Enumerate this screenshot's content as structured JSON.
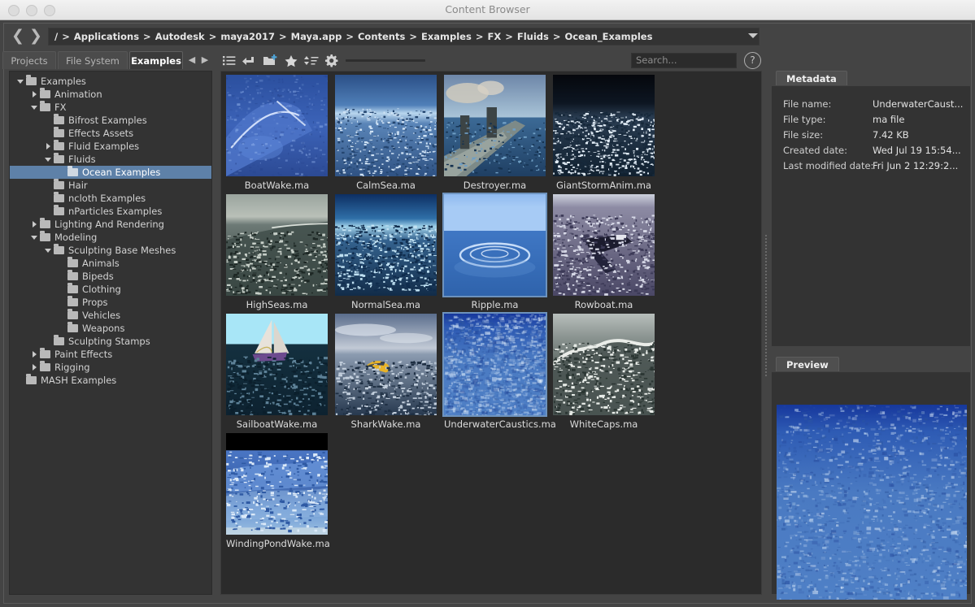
{
  "window": {
    "title": "Content Browser",
    "traffic_lights": [
      "close",
      "minimize",
      "zoom"
    ]
  },
  "breadcrumb": {
    "back_icon": "chevron-left-icon",
    "forward_icon": "chevron-right-icon",
    "segments": [
      "/",
      "Applications",
      "Autodesk",
      "maya2017",
      "Maya.app",
      "Contents",
      "Examples",
      "FX",
      "Fluids",
      "Ocean_Examples"
    ],
    "separator": ">",
    "dropdown_icon": "chevron-down-icon"
  },
  "tabs": [
    {
      "label": "Projects",
      "active": false
    },
    {
      "label": "File System",
      "active": false
    },
    {
      "label": "Examples",
      "active": true
    }
  ],
  "toolbar": {
    "icons": [
      {
        "name": "list-view-icon",
        "tip": "List view"
      },
      {
        "name": "up-one-level-icon",
        "tip": "Up one level"
      },
      {
        "name": "new-folder-icon",
        "tip": "New folder"
      },
      {
        "name": "favorite-star-icon",
        "tip": "Favorites"
      },
      {
        "name": "sort-icon",
        "tip": "Sort"
      },
      {
        "name": "settings-gear-icon",
        "tip": "Settings"
      }
    ],
    "zoom_slider_value": 25,
    "help_label": "?"
  },
  "search": {
    "value": "",
    "placeholder": "Search..."
  },
  "tree": {
    "items": [
      {
        "label": "Examples",
        "depth": 0,
        "twist": "open",
        "selected": false
      },
      {
        "label": "Animation",
        "depth": 1,
        "twist": "closed",
        "selected": false
      },
      {
        "label": "FX",
        "depth": 1,
        "twist": "open",
        "selected": false
      },
      {
        "label": "Bifrost Examples",
        "depth": 2,
        "twist": "none",
        "selected": false
      },
      {
        "label": "Effects Assets",
        "depth": 2,
        "twist": "none",
        "selected": false
      },
      {
        "label": "Fluid Examples",
        "depth": 2,
        "twist": "closed",
        "selected": false
      },
      {
        "label": "Fluids",
        "depth": 2,
        "twist": "open",
        "selected": false
      },
      {
        "label": "Ocean Examples",
        "depth": 3,
        "twist": "none",
        "selected": true
      },
      {
        "label": "Hair",
        "depth": 2,
        "twist": "none",
        "selected": false
      },
      {
        "label": "ncloth Examples",
        "depth": 2,
        "twist": "none",
        "selected": false
      },
      {
        "label": "nParticles Examples",
        "depth": 2,
        "twist": "none",
        "selected": false
      },
      {
        "label": "Lighting And Rendering",
        "depth": 1,
        "twist": "closed",
        "selected": false
      },
      {
        "label": "Modeling",
        "depth": 1,
        "twist": "open",
        "selected": false
      },
      {
        "label": "Sculpting Base Meshes",
        "depth": 2,
        "twist": "open",
        "selected": false
      },
      {
        "label": "Animals",
        "depth": 3,
        "twist": "none",
        "selected": false
      },
      {
        "label": "Bipeds",
        "depth": 3,
        "twist": "none",
        "selected": false
      },
      {
        "label": "Clothing",
        "depth": 3,
        "twist": "none",
        "selected": false
      },
      {
        "label": "Props",
        "depth": 3,
        "twist": "none",
        "selected": false
      },
      {
        "label": "Vehicles",
        "depth": 3,
        "twist": "none",
        "selected": false
      },
      {
        "label": "Weapons",
        "depth": 3,
        "twist": "none",
        "selected": false
      },
      {
        "label": "Sculpting Stamps",
        "depth": 2,
        "twist": "none",
        "selected": false
      },
      {
        "label": "Paint Effects",
        "depth": 1,
        "twist": "closed",
        "selected": false
      },
      {
        "label": "Rigging",
        "depth": 1,
        "twist": "closed",
        "selected": false
      },
      {
        "label": "MASH Examples",
        "depth": 0,
        "twist": "none",
        "selected": false
      }
    ]
  },
  "files": [
    {
      "name": "BoatWake.ma",
      "art": "boatwake",
      "selected": false
    },
    {
      "name": "CalmSea.ma",
      "art": "calmsea",
      "selected": false
    },
    {
      "name": "Destroyer.ma",
      "art": "destroyer",
      "selected": false
    },
    {
      "name": "GiantStormAnim.ma",
      "art": "giantstorm",
      "selected": false
    },
    {
      "name": "HighSeas.ma",
      "art": "highseas",
      "selected": false
    },
    {
      "name": "NormalSea.ma",
      "art": "normalsea",
      "selected": false
    },
    {
      "name": "Ripple.ma",
      "art": "ripple",
      "selected": true
    },
    {
      "name": "Rowboat.ma",
      "art": "rowboat",
      "selected": false
    },
    {
      "name": "SailboatWake.ma",
      "art": "sailboat",
      "selected": false
    },
    {
      "name": "SharkWake.ma",
      "art": "sharkwake",
      "selected": false
    },
    {
      "name": "UnderwaterCaustics.ma",
      "art": "caustics",
      "selected": true
    },
    {
      "name": "WhiteCaps.ma",
      "art": "whitecaps",
      "selected": false
    },
    {
      "name": "WindingPondWake.ma",
      "art": "pondwake",
      "selected": false
    }
  ],
  "metadata": {
    "tab_label": "Metadata",
    "rows": [
      {
        "key": "File name:",
        "value": "UnderwaterCaust..."
      },
      {
        "key": "File type:",
        "value": "ma file"
      },
      {
        "key": "File size:",
        "value": "7.42 KB"
      },
      {
        "key": "Created date:",
        "value": "Wed Jul 19 15:54..."
      },
      {
        "key": "Last modified date:",
        "value": "Fri Jun 2 12:29:2..."
      }
    ]
  },
  "preview": {
    "tab_label": "Preview",
    "art": "caustics"
  },
  "colors": {
    "selection_blue": "#5e81a8",
    "thumb_select_outline": "#6d92bd",
    "panel_bg": "#333333",
    "app_bg": "#444444",
    "grid_bg": "#2b2b2b",
    "text": "#d2d2d2"
  }
}
